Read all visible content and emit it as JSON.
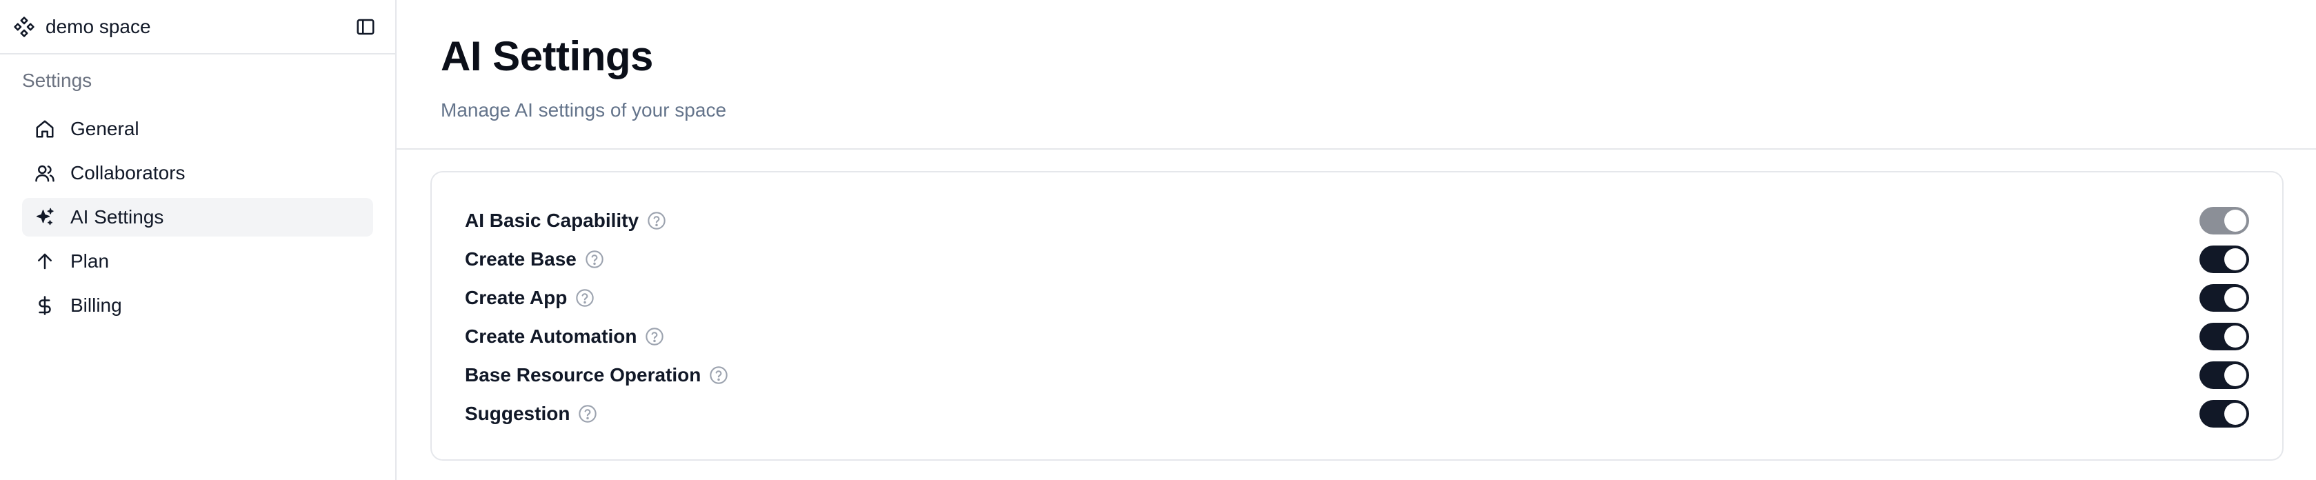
{
  "sidebar": {
    "space_name": "demo space",
    "section_label": "Settings",
    "items": [
      {
        "label": "General",
        "icon": "home-icon",
        "active": false
      },
      {
        "label": "Collaborators",
        "icon": "users-icon",
        "active": false
      },
      {
        "label": "AI Settings",
        "icon": "sparkles-icon",
        "active": true
      },
      {
        "label": "Plan",
        "icon": "arrow-up-icon",
        "active": false
      },
      {
        "label": "Billing",
        "icon": "dollar-icon",
        "active": false
      }
    ]
  },
  "page": {
    "title": "AI Settings",
    "subtitle": "Manage AI settings of your space"
  },
  "settings": [
    {
      "label": "AI Basic Capability",
      "enabled": true,
      "disabled": true
    },
    {
      "label": "Create Base",
      "enabled": true,
      "disabled": false
    },
    {
      "label": "Create App",
      "enabled": true,
      "disabled": false
    },
    {
      "label": "Create Automation",
      "enabled": true,
      "disabled": false
    },
    {
      "label": "Base Resource Operation",
      "enabled": true,
      "disabled": false
    },
    {
      "label": "Suggestion",
      "enabled": true,
      "disabled": false
    }
  ],
  "colors": {
    "switch_on": "#111827",
    "switch_disabled": "#8b8f97",
    "active_nav_bg": "#f3f4f6"
  }
}
